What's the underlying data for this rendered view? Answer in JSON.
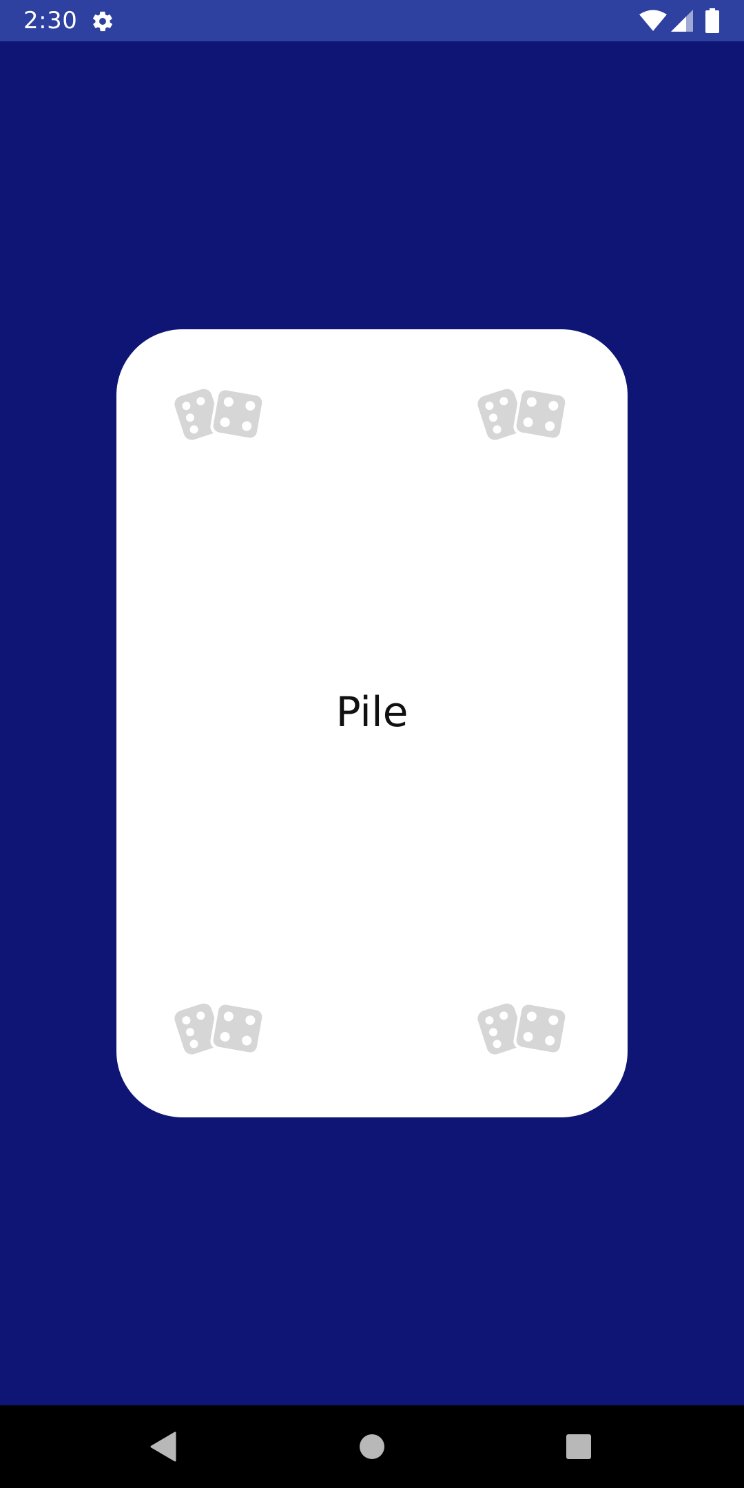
{
  "status_bar": {
    "time": "2:30",
    "icons": [
      "gear-icon",
      "wifi-icon",
      "cell-signal-icon",
      "battery-icon"
    ],
    "background": "#2e40a0"
  },
  "screen": {
    "background": "#0e1575"
  },
  "card": {
    "label": "Pile",
    "background": "#ffffff",
    "corner_icons": [
      "dice-icon",
      "dice-icon",
      "dice-icon",
      "dice-icon"
    ],
    "icon_color": "#d6d6d6"
  },
  "nav_bar": {
    "buttons": [
      "back-icon",
      "home-icon",
      "recents-icon"
    ],
    "background": "#000000",
    "icon_color": "#b8b8b8"
  }
}
